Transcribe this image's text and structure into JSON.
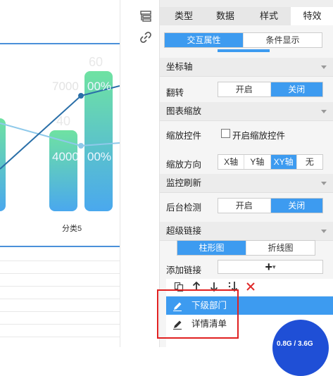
{
  "chart": {
    "bar_top_labels": [
      "60",
      "40"
    ],
    "bar_inner_labels": [
      "7000",
      "00%",
      "4000",
      "00%"
    ],
    "category_label": "分类5",
    "colors": {
      "bar_top": "#6fe2a2",
      "bar_bottom": "#4aa8ee",
      "line_dark": "#2a6fa8",
      "line_light": "#8ec9ea"
    }
  },
  "tabs": [
    {
      "label": "类型"
    },
    {
      "label": "数据"
    },
    {
      "label": "样式"
    },
    {
      "label": "特效"
    }
  ],
  "interaction": {
    "tab1": "交互属性",
    "tab2": "条件显示"
  },
  "axis": {
    "title": "坐标轴",
    "flip_label": "翻转",
    "on": "开启",
    "off": "关闭"
  },
  "zoom": {
    "title": "图表缩放",
    "control_label": "缩放控件",
    "control_checkbox": "开启缩放控件",
    "direction_label": "缩放方向",
    "directions": [
      "X轴",
      "Y轴",
      "XY轴",
      "无"
    ]
  },
  "monitor": {
    "title": "监控刷新",
    "check_label": "后台检测",
    "on": "开启",
    "off": "关闭"
  },
  "hyperlink": {
    "title": "超级链接",
    "tab_bar": "柱形图",
    "tab_line": "折线图",
    "add_label": "添加链接",
    "add_symbol": "+",
    "items": [
      {
        "label": "下级部门"
      },
      {
        "label": "详情清单"
      }
    ]
  },
  "memory_badge": {
    "text": "0.8G / 3.6G"
  }
}
